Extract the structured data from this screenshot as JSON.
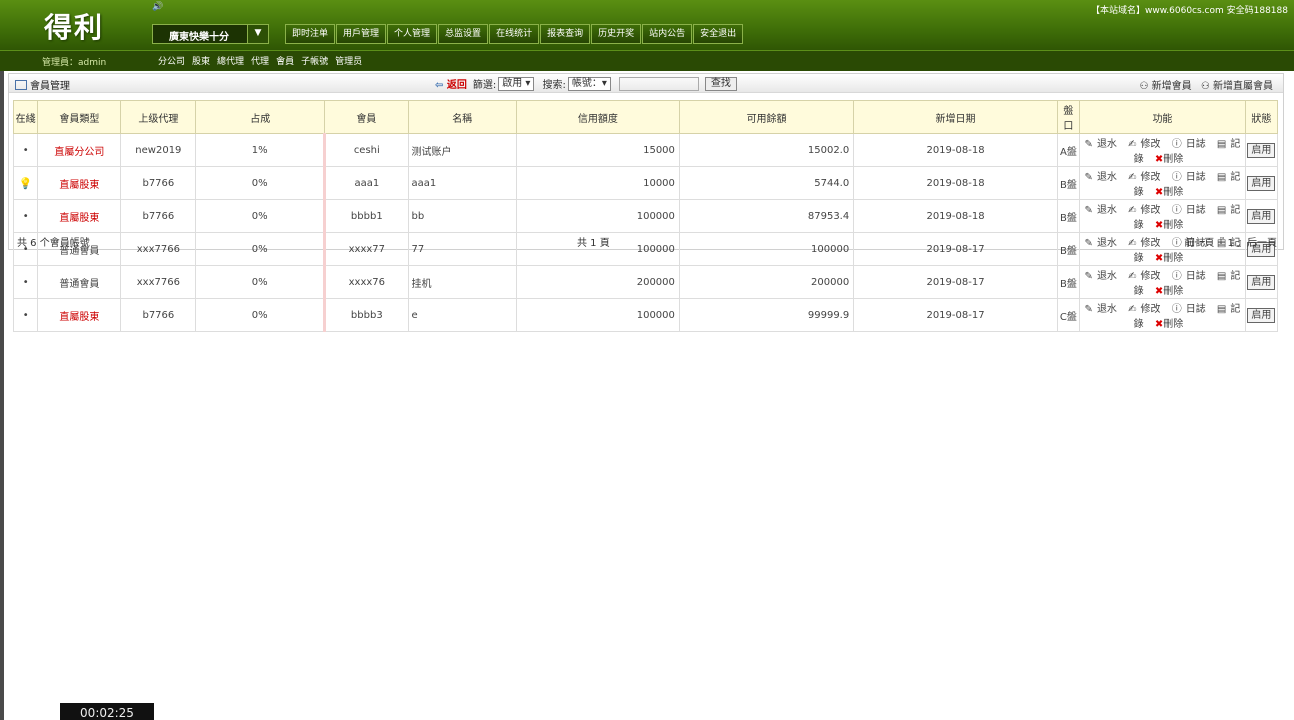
{
  "header": {
    "logo": "得利",
    "speaker_icon": "🔊",
    "game_select": "廣東快樂十分",
    "site_info": "【本站域名】www.6060cs.com 安全码188188",
    "nav": [
      "即时注单",
      "用戶管理",
      "个人管理",
      "总监设置",
      "在线统计",
      "报表查询",
      "历史开奖",
      "站内公告",
      "安全退出"
    ],
    "admin": "管理員：admin",
    "subnav": [
      "分公司",
      "股東",
      "總代理",
      "代理",
      "會員",
      "子帳號",
      "管理员"
    ]
  },
  "panel": {
    "title": "會員管理",
    "back": "返回",
    "filter_label": "篩選:",
    "filter_value": "啟用",
    "search_label": "搜索:",
    "search_field": "帳號：",
    "search_button": "查找",
    "add_member": "新增會員",
    "add_direct": "新增直屬會員"
  },
  "table": {
    "headers": [
      "在綫",
      "會員類型",
      "上级代理",
      "占成",
      "會員",
      "名稱",
      "信用額度",
      "可用餘額",
      "新增日期",
      "盤口",
      "功能",
      "狀態"
    ],
    "rows": [
      {
        "online": "•",
        "type": "直屬分公司",
        "agent": "new2019",
        "share": "1%",
        "member": "ceshi",
        "name": "测试账户",
        "credit": "15000",
        "balance": "15002.0",
        "date": "2019-08-18",
        "pan": "A盤",
        "status": "启用"
      },
      {
        "online": "bulb",
        "type": "直屬股東",
        "agent": "b7766",
        "share": "0%",
        "member": "aaa1",
        "name": "aaa1",
        "credit": "10000",
        "balance": "5744.0",
        "date": "2019-08-18",
        "pan": "B盤",
        "status": "启用"
      },
      {
        "online": "•",
        "type": "直屬股東",
        "agent": "b7766",
        "share": "0%",
        "member": "bbbb1",
        "name": "bb",
        "credit": "100000",
        "balance": "87953.4",
        "date": "2019-08-18",
        "pan": "B盤",
        "status": "启用"
      },
      {
        "online": "•",
        "type": "普通會員",
        "agent": "xxx7766",
        "share": "0%",
        "member": "xxxx77",
        "name": "77",
        "credit": "100000",
        "balance": "100000",
        "date": "2019-08-17",
        "pan": "B盤",
        "status": "启用"
      },
      {
        "online": "•",
        "type": "普通會員",
        "agent": "xxx7766",
        "share": "0%",
        "member": "xxxx76",
        "name": "挂机",
        "credit": "200000",
        "balance": "200000",
        "date": "2019-08-17",
        "pan": "B盤",
        "status": "启用"
      },
      {
        "online": "•",
        "type": "直屬股東",
        "agent": "b7766",
        "share": "0%",
        "member": "bbbb3",
        "name": "e",
        "credit": "100000",
        "balance": "99999.9",
        "date": "2019-08-17",
        "pan": "C盤",
        "status": "启用"
      }
    ],
    "func": {
      "tuishui": "退水",
      "edit": "修改",
      "log": "日誌",
      "record": "記錄",
      "delete": "刪除"
    }
  },
  "footer": {
    "count": "共 6 个會員帳號",
    "pages": "共 1 頁",
    "pager": "前一頁『 1 』后一頁"
  },
  "timer": "00:02:25",
  "colors": {
    "header": "#3f6e08",
    "accent_red": "#cc0000",
    "table_header": "#fffbdc"
  }
}
